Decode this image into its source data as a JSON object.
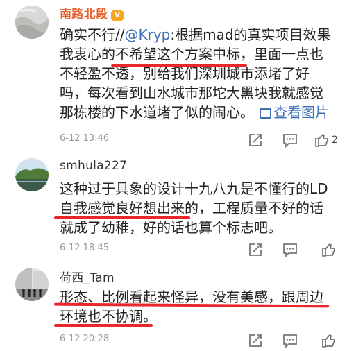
{
  "comments": [
    {
      "username": "南路北段",
      "vip": true,
      "lines": [
        {
          "parts": [
            "确实不行//",
            "@Kryp",
            ":根据mad的真实项目效果"
          ]
        },
        {
          "parts": [
            "我衷心的不希望这个方案中标，里面一点也"
          ]
        },
        {
          "parts": [
            "不轻盈不透，别给我们深圳城市添堵了好"
          ]
        },
        {
          "parts": [
            "吗，每次看到山水城市那坨大黑块我就感觉"
          ]
        },
        {
          "parts": [
            "那栋楼的下水道堵了似的闹心。"
          ]
        }
      ],
      "view_image_label": "查看图片",
      "time": "6-12 13:46",
      "like_count": "2"
    },
    {
      "username": "smhula227",
      "vip": false,
      "lines": [
        {
          "parts": [
            "这种过于具象的设计十九八九是不懂行的LD"
          ]
        },
        {
          "parts": [
            "自我感觉良好想出来的，工程质量不好的话"
          ]
        },
        {
          "parts": [
            "就成了幼稚，好的话也算个标志吧。"
          ]
        }
      ],
      "time": "6-12 18:45",
      "like_count": ""
    },
    {
      "username": "荷西_Tam",
      "vip": false,
      "lines": [
        {
          "parts": [
            "形态、比例看起来怪异，没有美感，跟周边"
          ]
        },
        {
          "parts": [
            "环境也不协调。"
          ]
        }
      ],
      "time": "6-12 20:28",
      "like_count": ""
    }
  ],
  "colors": {
    "vip_name": "#e8612c",
    "link": "#3d6fb6",
    "underline": "#e8262c",
    "meta": "#999999"
  },
  "icons": [
    "forward-icon",
    "comment-icon",
    "like-icon",
    "picture-icon",
    "vip-badge-icon"
  ]
}
